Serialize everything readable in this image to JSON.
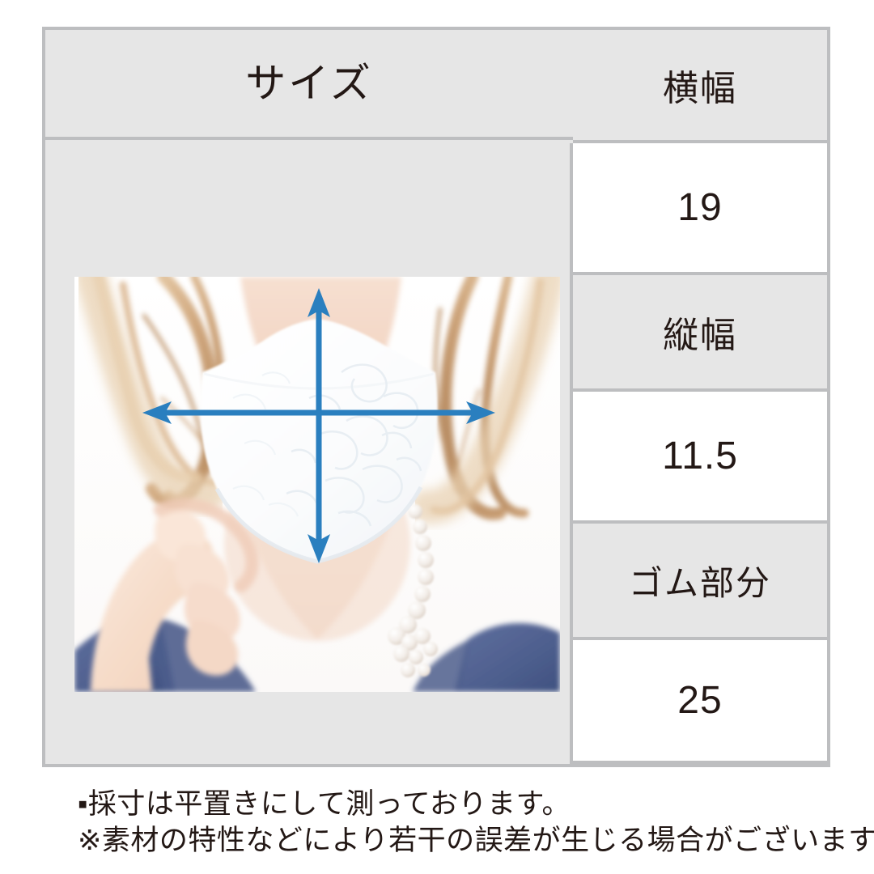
{
  "table": {
    "header_left": "サイズ",
    "rows": [
      {
        "label": "横幅",
        "value": "19"
      },
      {
        "label": "縦幅",
        "value": "11.5"
      },
      {
        "label": "ゴム部分",
        "value": "25"
      }
    ]
  },
  "photo": {
    "alt": "白いレースマスクを着けた女性の写真",
    "measure_arrows": {
      "horizontal": "横幅矢印",
      "vertical": "縦幅矢印"
    }
  },
  "notes": {
    "line1": "▪採寸は平置きにして測っております。",
    "line2": "※素材の特性などにより若干の誤差が生じる場合がございます。"
  },
  "colors": {
    "border": "#bdbec0",
    "cell_gray": "#e6e6e6",
    "cell_white": "#ffffff",
    "text": "#231815",
    "arrow_blue": "#2a7fbf",
    "page_bg": "#ffffff"
  }
}
